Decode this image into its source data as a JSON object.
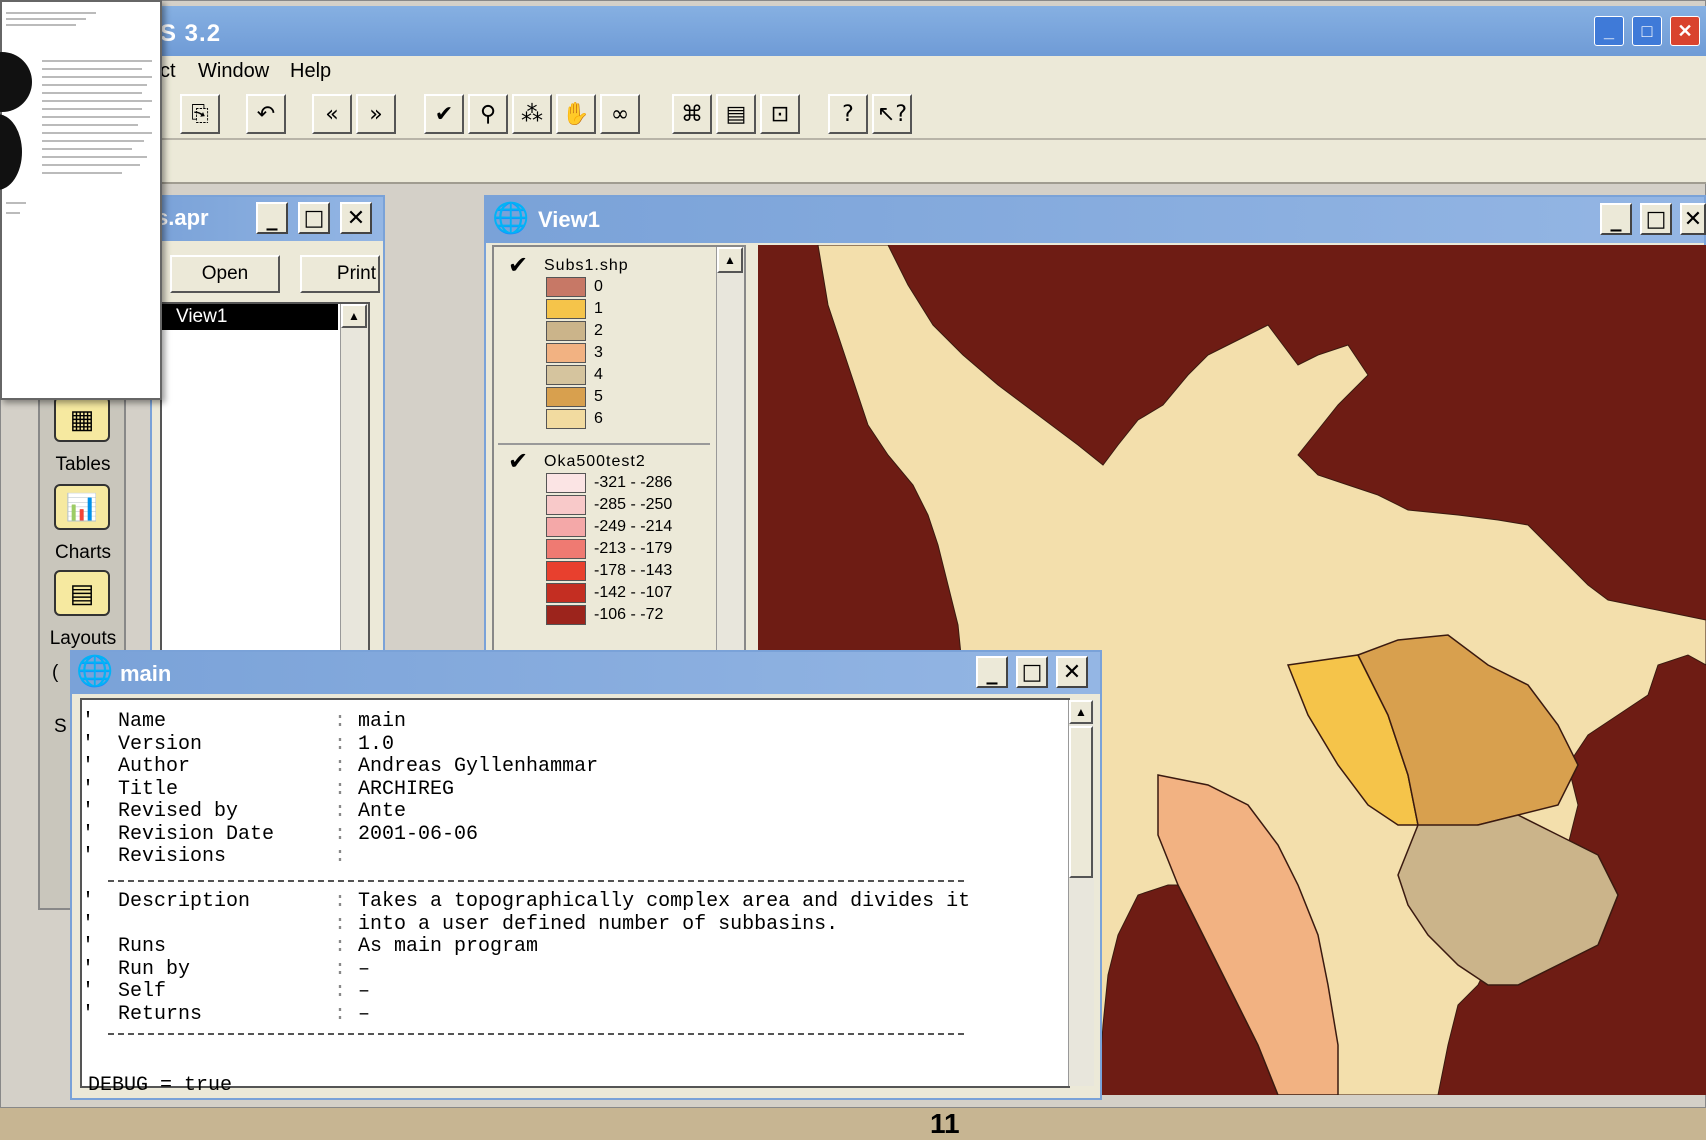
{
  "app": {
    "title": "S 3.2",
    "menu": [
      "ct",
      "Window",
      "Help"
    ],
    "toolbar": [
      "clipboard-icon",
      "undo-icon",
      "prev-icon",
      "next-icon",
      "check-icon",
      "walk-icon",
      "step-icon",
      "hand-icon",
      "link-icon",
      "properties-icon",
      "open-icon",
      "view-icon",
      "help-icon",
      "context-help-icon"
    ],
    "toolbar_glyphs": [
      "⎘",
      "↶",
      "«",
      "»",
      "✔",
      "⚲",
      "⁂",
      "✋",
      "∞",
      "⌘",
      "▤",
      "⊡",
      "?",
      "↖?"
    ]
  },
  "project": {
    "title": "s.apr",
    "open_label": "Open",
    "print_label": "Print",
    "selected_item": "View1"
  },
  "icon_strip": {
    "items": [
      "Tables",
      "Charts",
      "Layouts"
    ],
    "partial_label": "S"
  },
  "view": {
    "title": "View1",
    "themes": [
      {
        "name": "Subs1.shp",
        "checked": true,
        "classes": [
          {
            "label": "0",
            "color": "#c77866"
          },
          {
            "label": "1",
            "color": "#f5c44a"
          },
          {
            "label": "2",
            "color": "#cbb48a"
          },
          {
            "label": "3",
            "color": "#f2b282"
          },
          {
            "label": "4",
            "color": "#d5c49e"
          },
          {
            "label": "5",
            "color": "#d8a04e"
          },
          {
            "label": "6",
            "color": "#f2dba0"
          }
        ]
      },
      {
        "name": "Oka500test2",
        "checked": true,
        "classes": [
          {
            "label": "-321 - -286",
            "color": "#fbe4e4"
          },
          {
            "label": "-285 - -250",
            "color": "#f8c9c9"
          },
          {
            "label": "-249 - -214",
            "color": "#f4a8a8"
          },
          {
            "label": "-213 - -179",
            "color": "#ef7a72"
          },
          {
            "label": "-178 - -143",
            "color": "#e8402e"
          },
          {
            "label": "-142 - -107",
            "color": "#c42e22"
          },
          {
            "label": "-106 - -72",
            "color": "#9c241c"
          }
        ]
      }
    ]
  },
  "script": {
    "title": "main",
    "header_rows": [
      {
        "key": "Name",
        "value": "main"
      },
      {
        "key": "Version",
        "value": "1.0"
      },
      {
        "key": "Author",
        "value": "Andreas Gyllenhammar"
      },
      {
        "key": "Title",
        "value": "ARCHIREG"
      },
      {
        "key": "Revised by",
        "value": "Ante"
      },
      {
        "key": "Revision Date",
        "value": "2001-06-06"
      },
      {
        "key": "Revisions",
        "value": ""
      }
    ],
    "desc_rows": [
      {
        "key": "Description",
        "value": "Takes a topographically complex area and divides it"
      },
      {
        "key": "",
        "value": "into a user defined number of subbasins."
      },
      {
        "key": "Runs",
        "value": "As main program"
      },
      {
        "key": "Run by",
        "value": "–"
      },
      {
        "key": "Self",
        "value": "–"
      },
      {
        "key": "Returns",
        "value": "–"
      }
    ],
    "debug_line": "DEBUG = true"
  },
  "page_number": "11",
  "colors": {
    "map_background": "#6e1c14",
    "lake": "#f3dfac",
    "titlebar": "#7aa2d8"
  }
}
